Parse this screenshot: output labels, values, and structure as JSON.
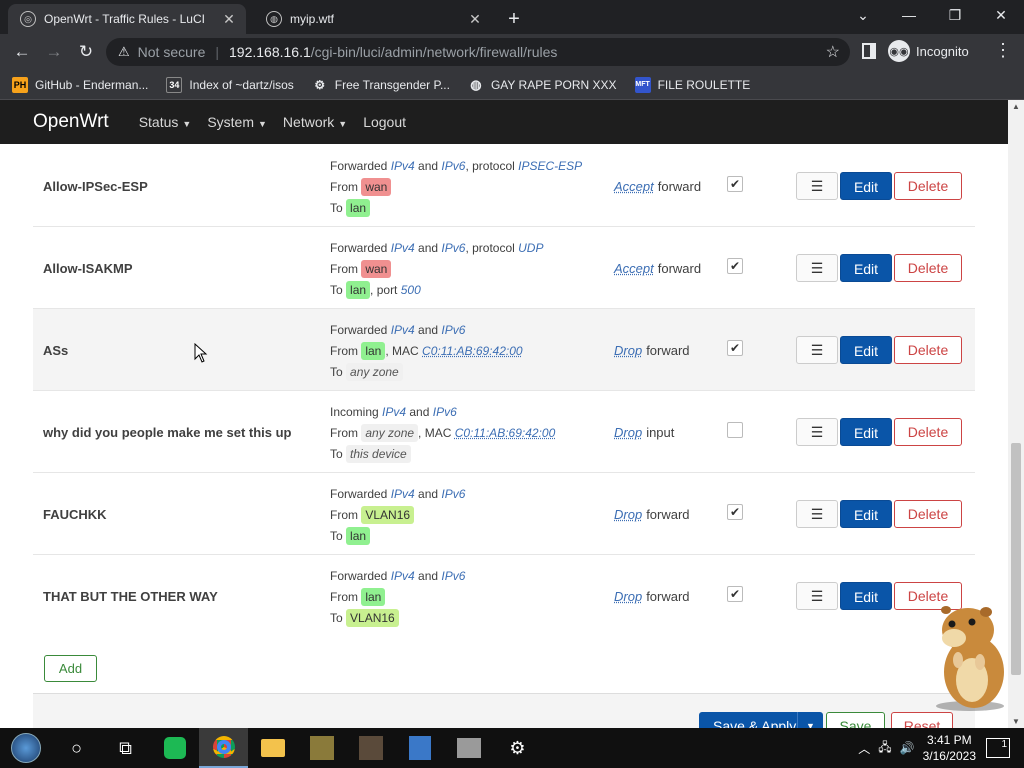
{
  "browser": {
    "tabs": [
      {
        "title": "OpenWrt - Traffic Rules - LuCI",
        "active": true
      },
      {
        "title": "myip.wtf",
        "active": false
      }
    ],
    "new_tab": "+",
    "address": {
      "security": "Not secure",
      "host": "192.168.16.1",
      "path": "/cgi-bin/luci/admin/network/firewall/rules"
    },
    "profile": "Incognito",
    "bookmarks": [
      {
        "label": "GitHub - Enderman...",
        "icon": "PH",
        "color": "#f7a21b"
      },
      {
        "label": "Index of ~dartz/isos",
        "icon": "34",
        "color": "#ffffff"
      },
      {
        "label": "Free Transgender P...",
        "icon": "gear",
        "color": "#e8eaed"
      },
      {
        "label": "GAY RAPE PORN XXX",
        "icon": "globe",
        "color": "#e8eaed"
      },
      {
        "label": "FILE ROULETTE",
        "icon": "MFT",
        "color": "#3355cc"
      }
    ]
  },
  "luci": {
    "brand": "OpenWrt",
    "menu": [
      "Status",
      "System",
      "Network",
      "Logout"
    ]
  },
  "rules": [
    {
      "name": "Allow-IPSec-ESP",
      "lines": {
        "l1_pre": "Forwarded ",
        "l1_a": "IPv4",
        "l1_mid": " and ",
        "l1_b": "IPv6",
        "l1_post": ", protocol ",
        "l1_proto": "IPSEC-ESP",
        "from_label": "From",
        "from_zone": "wan",
        "to_label": "To",
        "to_zone": "lan"
      },
      "action": "Accept",
      "action_suffix": "forward",
      "enabled": true
    },
    {
      "name": "Allow-ISAKMP",
      "lines": {
        "l1_pre": "Forwarded ",
        "l1_a": "IPv4",
        "l1_mid": " and ",
        "l1_b": "IPv6",
        "l1_post": ", protocol ",
        "l1_proto": "UDP",
        "from_label": "From",
        "from_zone": "wan",
        "to_label": "To",
        "to_zone": "lan",
        "to_port_label": ", port ",
        "to_port": "500"
      },
      "action": "Accept",
      "action_suffix": "forward",
      "enabled": true
    },
    {
      "name": "ASs",
      "lines": {
        "l1_pre": "Forwarded ",
        "l1_a": "IPv4",
        "l1_mid": " and ",
        "l1_b": "IPv6",
        "from_label": "From",
        "from_zone": "lan",
        "from_mac_label": ", MAC ",
        "from_mac": "C0:11:AB:69:42:00",
        "to_label": "To",
        "to_zone": "any zone"
      },
      "action": "Drop",
      "action_suffix": "forward",
      "enabled": true
    },
    {
      "name": "why did you people make me set this up",
      "lines": {
        "l1_pre": "Incoming ",
        "l1_a": "IPv4",
        "l1_mid": " and ",
        "l1_b": "IPv6",
        "from_label": "From",
        "from_zone": "any zone",
        "from_mac_label": ", MAC ",
        "from_mac": "C0:11:AB:69:42:00",
        "to_label": "To",
        "to_zone": "this device"
      },
      "action": "Drop",
      "action_suffix": "input",
      "enabled": false
    },
    {
      "name": "FAUCHKK",
      "lines": {
        "l1_pre": "Forwarded ",
        "l1_a": "IPv4",
        "l1_mid": " and ",
        "l1_b": "IPv6",
        "from_label": "From",
        "from_zone": "VLAN16",
        "to_label": "To",
        "to_zone": "lan"
      },
      "action": "Drop",
      "action_suffix": "forward",
      "enabled": true
    },
    {
      "name": "THAT BUT THE OTHER WAY",
      "lines": {
        "l1_pre": "Forwarded ",
        "l1_a": "IPv4",
        "l1_mid": " and ",
        "l1_b": "IPv6",
        "from_label": "From",
        "from_zone": "lan",
        "to_label": "To",
        "to_zone": "VLAN16"
      },
      "action": "Drop",
      "action_suffix": "forward",
      "enabled": true
    }
  ],
  "row_buttons": {
    "drag": "☰",
    "edit": "Edit",
    "delete": "Delete"
  },
  "footer": {
    "add": "Add",
    "save_apply": "Save & Apply",
    "save": "Save",
    "reset": "Reset"
  },
  "taskbar": {
    "time": "3:41 PM",
    "date": "3/16/2023",
    "notifications": "1"
  }
}
